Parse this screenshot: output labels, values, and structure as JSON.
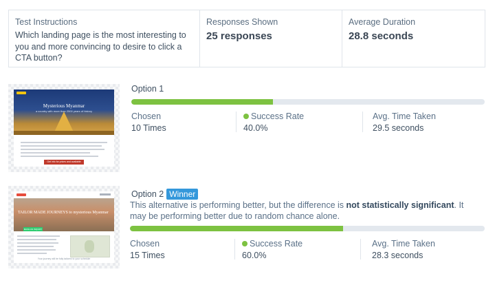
{
  "summary": {
    "instructions_label": "Test Instructions",
    "instructions_text": "Which landing page is the most interesting to you and more convincing to desire to click a CTA button?",
    "responses_label": "Responses Shown",
    "responses_value": "25 responses",
    "duration_label": "Average Duration",
    "duration_value": "28.8 seconds"
  },
  "options": [
    {
      "title": "Option 1",
      "success_fraction": 0.4,
      "chosen_label": "Chosen",
      "chosen_value": "10 Times",
      "success_label": "Success Rate",
      "success_value": "40.0%",
      "time_label": "Avg. Time Taken",
      "time_value": "29.5 seconds",
      "thumb": {
        "headline": "Mysterious Myanmar",
        "subline": "a country with more than 2500 years of history",
        "cta": "Get info for prices and available dates"
      }
    },
    {
      "title": "Option 2",
      "badge": "Winner",
      "desc_prefix": "This alternative is performing better, but the difference is ",
      "desc_strong": "not statistically significant",
      "desc_suffix": ". It may be performing better due to random chance alone.",
      "success_fraction": 0.6,
      "chosen_label": "Chosen",
      "chosen_value": "15 Times",
      "success_label": "Success Rate",
      "success_value": "60.0%",
      "time_label": "Avg. Time Taken",
      "time_value": "28.3 seconds",
      "thumb": {
        "headline": "TAILOR MADE JOURNEYS to mysterious Myanmar",
        "cta": "MAKE AN INQUIRY",
        "footer": "Your journey will be fully tailored to your schedule"
      }
    }
  ],
  "colors": {
    "success": "#7dc241",
    "track": "#e3e8ee",
    "winner_badge": "#3498db"
  }
}
